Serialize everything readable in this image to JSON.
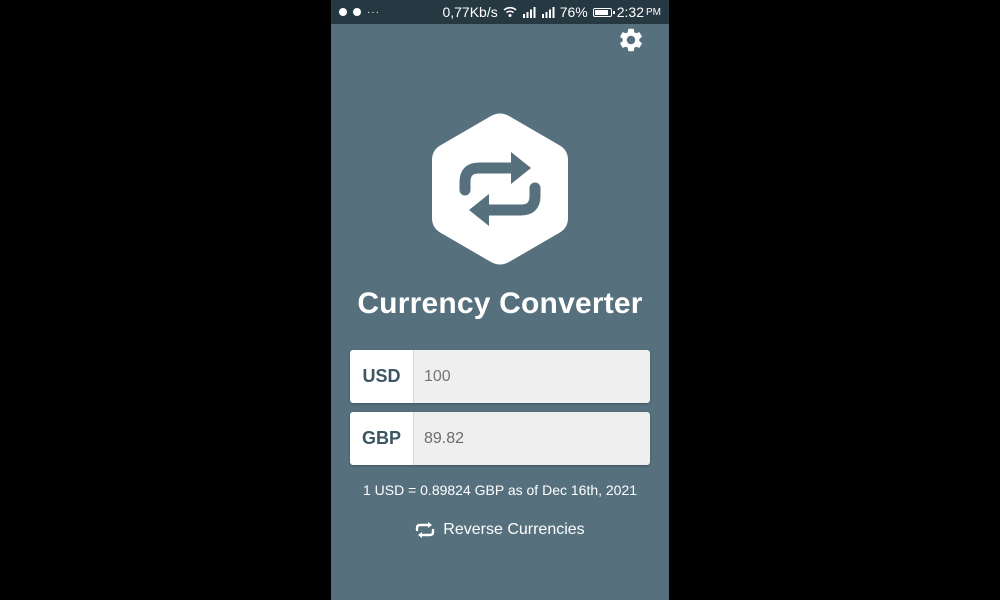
{
  "status_bar": {
    "dots": "···",
    "network_speed": "0,77Kb/s",
    "battery": "76%",
    "battery_level": 0.76,
    "time": "2:32",
    "ampm": "PM"
  },
  "app": {
    "title": "Currency Converter",
    "settings_icon": "gear-icon",
    "logo_icon": "exchange-arrows-hexagon-icon"
  },
  "from": {
    "currency": "USD",
    "placeholder": "100"
  },
  "to": {
    "currency": "GBP",
    "value": "89.82"
  },
  "rate_text": "1 USD = 0.89824 GBP as of Dec 16th, 2021",
  "reverse": {
    "label": "Reverse Currencies",
    "icon": "swap-arrows-icon"
  },
  "colors": {
    "background": "#56707e",
    "status_bar": "#263842",
    "label_text": "#3d5663"
  }
}
